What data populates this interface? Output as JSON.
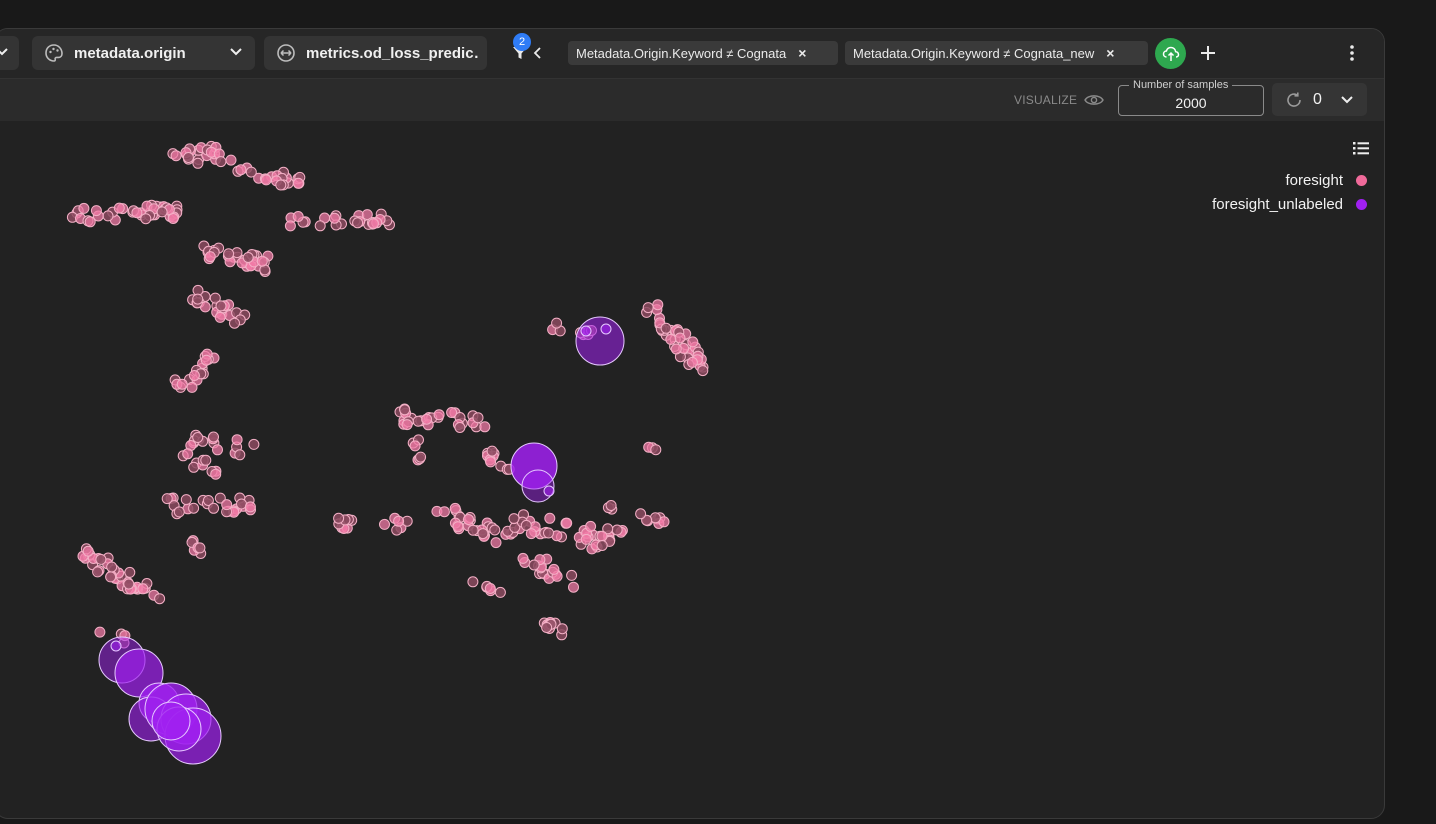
{
  "toolbar": {
    "color_by": {
      "label": "metadata.origin",
      "icon": "palette-icon"
    },
    "size_by": {
      "label": "metrics.od_loss_predic…",
      "icon": "size-arrows-icon"
    },
    "filter_count": "2",
    "filters": [
      "Metadata.Origin.Keyword ≠ Cognata",
      "Metadata.Origin.Keyword ≠ Cognata_new"
    ],
    "close_symbol": "×"
  },
  "subbar": {
    "visualize_label": "VISUALIZE",
    "samples_label": "Number of samples",
    "samples_value": "2000",
    "refresh_count": "0"
  },
  "legend": [
    {
      "label": "foresight",
      "color": "#f06a9a"
    },
    {
      "label": "foresight_unlabeled",
      "color": "#a020f0"
    }
  ],
  "colors": {
    "accent_blue": "#2f7cf6",
    "upload_green": "#2ea84f",
    "point_pink_fill": "#8b4a5f",
    "point_pink_stroke": "#f3b0c6",
    "point_purple": "#a020f0"
  }
}
